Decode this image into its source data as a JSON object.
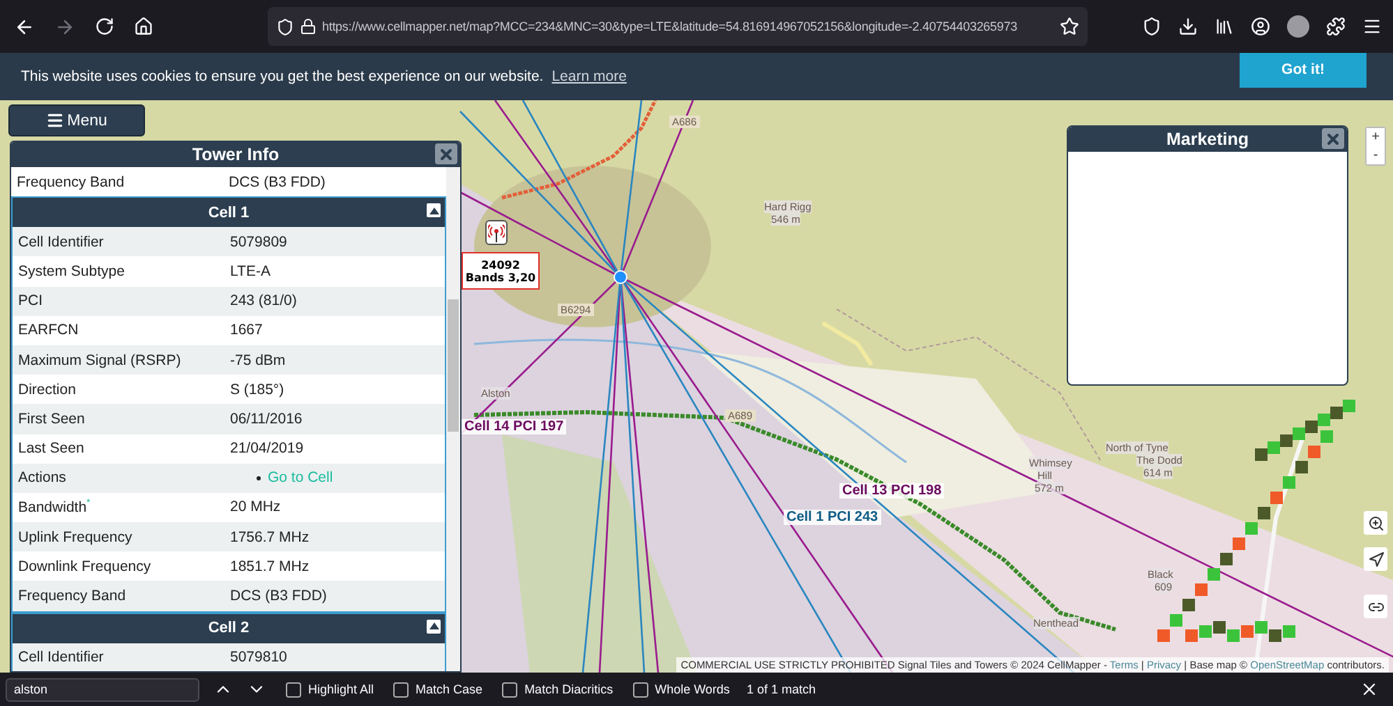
{
  "browser": {
    "url": "https://www.cellmapper.net/map?MCC=234&MNC=30&type=LTE&latitude=54.816914967052156&longitude=-2.40754403265973",
    "back_disabled": false,
    "forward_disabled": true
  },
  "cookie_banner": {
    "text": "This website uses cookies to ensure you get the best experience on our website.",
    "link": "Learn more",
    "button": "Got it!"
  },
  "menu_button": {
    "label": "Menu"
  },
  "tower_info": {
    "title": "Tower Info",
    "top_rows": [
      {
        "label": "Frequency Band",
        "value": "DCS (B3 FDD)",
        "kind": "text"
      }
    ],
    "cells": [
      {
        "title": "Cell 1",
        "expanded": true,
        "rows": [
          {
            "label": "Cell Identifier",
            "value": "5079809",
            "kind": "text"
          },
          {
            "label": "System Subtype",
            "value": "LTE-A",
            "kind": "text"
          },
          {
            "label": "PCI",
            "value": "243 (81/0)",
            "kind": "text"
          },
          {
            "label": "EARFCN",
            "value": "1667",
            "kind": "text"
          },
          {
            "label": "Maximum Signal (RSRP)",
            "value": "-75 dBm",
            "kind": "text"
          },
          {
            "label": "Direction",
            "value": "S (185°)",
            "kind": "text"
          },
          {
            "label": "First Seen",
            "value": "06/11/2016",
            "kind": "text"
          },
          {
            "label": "Last Seen",
            "value": "21/04/2019",
            "kind": "text"
          },
          {
            "label": "Actions",
            "value": "Go to Cell",
            "kind": "link"
          },
          {
            "label": "Bandwidth$^{*}$",
            "value": "20 MHz",
            "kind": "text"
          },
          {
            "label": "Uplink Frequency",
            "value": "1756.7 MHz",
            "kind": "text"
          },
          {
            "label": "Downlink Frequency",
            "value": "1851.7 MHz",
            "kind": "text"
          },
          {
            "label": "Frequency Band",
            "value": "DCS (B3 FDD)",
            "kind": "text"
          }
        ]
      },
      {
        "title": "Cell 2",
        "expanded": true,
        "rows": [
          {
            "label": "Cell Identifier",
            "value": "5079810",
            "kind": "text"
          }
        ]
      }
    ]
  },
  "map": {
    "tower": {
      "id": "24092",
      "bands": "Bands 3,20"
    },
    "cell_labels": [
      {
        "text": "Cell 14 PCI 197",
        "color": "#6b0a5e"
      },
      {
        "text": "Cell 13 PCI 198",
        "color": "#6b0a5e"
      },
      {
        "text": "Cell 1 PCI 243",
        "color": "#0f5d86"
      }
    ],
    "place_labels": [
      "A686",
      "B6294",
      "Hard Rigg",
      "546 m",
      "Alston",
      "A689",
      "North of Tyne",
      "Whimsey",
      "Hill",
      "572 m",
      "The Dodd",
      "614 m",
      "Black",
      "609",
      "Nenthead"
    ],
    "zoom_in": "+",
    "zoom_out": "-",
    "attribution": [
      {
        "kind": "text",
        "text": "COMMERCIAL USE STRICTLY PROHIBITED Signal Tiles and Towers © 2024 CellMapper -"
      },
      {
        "kind": "link",
        "text": "Terms"
      },
      {
        "kind": "text",
        "text": "|"
      },
      {
        "kind": "link",
        "text": "Privacy"
      },
      {
        "kind": "text",
        "text": "| Base map ©"
      },
      {
        "kind": "link",
        "text": "OpenStreetMap"
      },
      {
        "kind": "text",
        "text": "contributors."
      }
    ]
  },
  "marketing": {
    "title": "Marketing"
  },
  "find_bar": {
    "value": "alston",
    "options": [
      {
        "label": "Highlight All",
        "checked": false
      },
      {
        "label": "Match Case",
        "checked": false
      },
      {
        "label": "Match Diacritics",
        "checked": false
      },
      {
        "label": "Whole Words",
        "checked": false
      }
    ],
    "status": "1 of 1 match"
  }
}
